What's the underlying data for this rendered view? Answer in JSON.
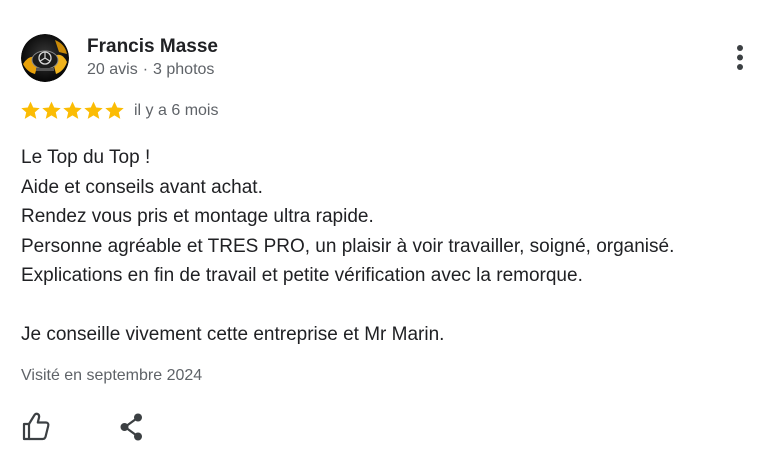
{
  "review": {
    "author": {
      "name": "Francis Masse",
      "review_count": "20 avis",
      "separator": "·",
      "photo_count": "3 photos",
      "avatar_icon": "car-logo-avatar"
    },
    "rating": {
      "stars": 5,
      "max_stars": 5,
      "star_color": "#fbbc04",
      "date": "il y a 6 mois"
    },
    "text_lines": [
      "Le Top du Top !",
      "Aide et conseils avant achat.",
      "Rendez vous pris et montage ultra rapide.",
      "Personne agréable et TRES PRO, un plaisir à voir travailler, soigné, organisé.",
      "Explications en fin de travail et petite vérification avec la remorque.",
      "",
      "Je conseille vivement cette entreprise et Mr Marin."
    ],
    "visited": "Visité en septembre 2024",
    "actions": {
      "like_icon": "thumbs-up-icon",
      "share_icon": "share-icon",
      "more_icon": "more-vertical-icon"
    }
  }
}
